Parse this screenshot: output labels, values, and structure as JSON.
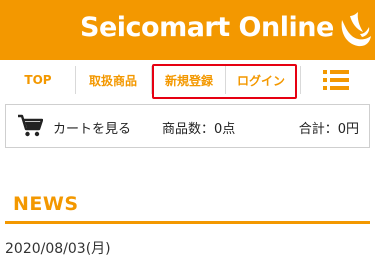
{
  "header": {
    "logo_text": "Seicomart Online",
    "logo_mark_icon": "seicomart-bird-logo-icon",
    "brand_color": "#f39800"
  },
  "nav": {
    "items": [
      {
        "label": "TOP"
      },
      {
        "label": "取扱商品"
      },
      {
        "label": "新規登録"
      },
      {
        "label": "ログイン"
      }
    ],
    "menu_icon": "hamburger-menu-icon",
    "highlight_color": "#e60012"
  },
  "cart": {
    "icon": "cart-icon",
    "link_label": "カートを見る",
    "count_text": "商品数：0点",
    "total_text": "合計：0円"
  },
  "news": {
    "heading": "NEWS",
    "date": "2020/08/03(月)"
  }
}
